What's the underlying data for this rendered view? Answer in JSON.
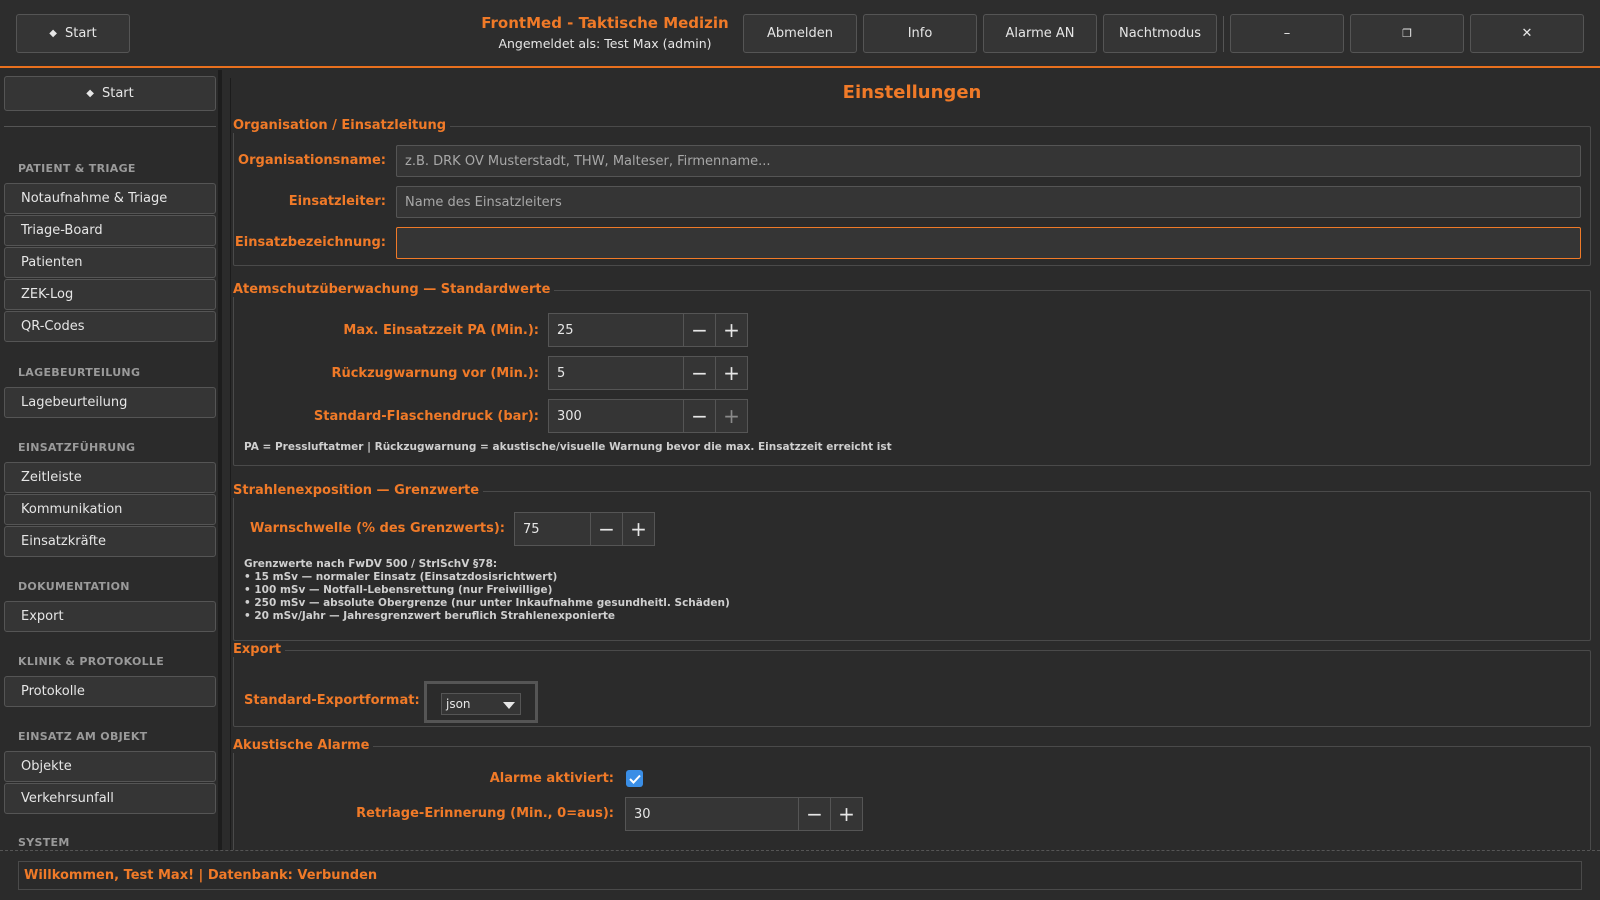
{
  "header": {
    "start_label": "Start",
    "app_title": "FrontMed - Taktische Medizin",
    "user_line": "Angemeldet als: Test Max (admin)",
    "buttons": {
      "logout": "Abmelden",
      "info": "Info",
      "alarms": "Alarme AN",
      "night_mode": "Nachtmodus",
      "minimize": "–",
      "maximize": "❐",
      "close": "✕"
    }
  },
  "sidebar": {
    "start_label": "Start",
    "sections": [
      {
        "title": "PATIENT & TRIAGE",
        "items": [
          "Notaufnahme & Triage",
          "Triage-Board",
          "Patienten",
          "ZEK-Log",
          "QR-Codes"
        ]
      },
      {
        "title": "LAGEBEURTEILUNG",
        "items": [
          "Lagebeurteilung"
        ]
      },
      {
        "title": "EINSATZFÜHRUNG",
        "items": [
          "Zeitleiste",
          "Kommunikation",
          "Einsatzkräfte"
        ]
      },
      {
        "title": "DOKUMENTATION",
        "items": [
          "Export"
        ]
      },
      {
        "title": "KLINIK & PROTOKOLLE",
        "items": [
          "Protokolle"
        ]
      },
      {
        "title": "EINSATZ AM OBJEKT",
        "items": [
          "Objekte",
          "Verkehrsunfall"
        ]
      },
      {
        "title": "SYSTEM",
        "items": []
      }
    ]
  },
  "main": {
    "title": "Einstellungen",
    "organisation": {
      "group_title": "Organisation / Einsatzleitung",
      "org_name_label": "Organisationsname:",
      "org_name_placeholder": "z.B. DRK OV Musterstadt, THW, Malteser, Firmenname...",
      "leader_label": "Einsatzleiter:",
      "leader_placeholder": "Name des Einsatzleiters",
      "mission_label": "Einsatzbezeichnung:",
      "mission_value": ""
    },
    "respiratory": {
      "group_title": "Atemschutzüberwachung — Standardwerte",
      "max_time_label": "Max. Einsatzzeit PA (Min.):",
      "max_time_value": "25",
      "retreat_label": "Rückzugwarnung vor (Min.):",
      "retreat_value": "5",
      "pressure_label": "Standard-Flaschendruck (bar):",
      "pressure_value": "300",
      "note": "PA = Pressluftatmer | Rückzugwarnung = akustische/visuelle Warnung bevor die max. Einsatzzeit erreicht ist"
    },
    "radiation": {
      "group_title": "Strahlenexposition — Grenzwerte",
      "threshold_label": "Warnschwelle (% des Grenzwerts):",
      "threshold_value": "75",
      "notes": [
        "Grenzwerte nach FwDV 500 / StrlSchV §78:",
        "• 15 mSv — normaler Einsatz (Einsatzdosisrichtwert)",
        "• 100 mSv — Notfall-Lebensrettung (nur Freiwillige)",
        "• 250 mSv — absolute Obergrenze (nur unter Inkaufnahme gesundheitl. Schäden)",
        "• 20 mSv/Jahr — Jahresgrenzwert beruflich Strahlenexponierte"
      ]
    },
    "export": {
      "group_title": "Export",
      "format_label": "Standard-Exportformat:",
      "format_value": "json"
    },
    "alarms": {
      "group_title": "Akustische Alarme",
      "enabled_label": "Alarme aktiviert:",
      "enabled": true,
      "retriage_label": "Retriage-Erinnerung (Min., 0=aus):",
      "retriage_value": "30"
    }
  },
  "status": {
    "text": "Willkommen, Test Max! | Datenbank: Verbunden"
  },
  "colors": {
    "accent": "#f07a28",
    "checkbox": "#3a8ee6"
  }
}
